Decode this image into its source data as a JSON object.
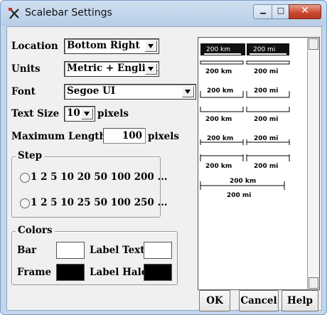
{
  "window": {
    "title": "Scalebar Settings"
  },
  "form": {
    "location_label": "Location",
    "location_value": "Bottom Right",
    "units_label": "Units",
    "units_value": "Metric + English",
    "font_label": "Font",
    "font_value": "Segoe UI",
    "text_size_label": "Text Size",
    "text_size_value": "10",
    "text_size_unit": "pixels",
    "max_length_label": "Maximum Length",
    "max_length_value": "100",
    "max_length_unit": "pixels"
  },
  "step": {
    "title": "Step",
    "option1": "1 2 5 10 20 50 100 200 ...",
    "option2": "1 2 5 10 25 50 100 250 ..."
  },
  "colors": {
    "title": "Colors",
    "bar_label": "Bar",
    "bar_color": "#ffffff",
    "label_text_label": "Label Text",
    "label_text_color": "#ffffff",
    "frame_label": "Frame",
    "frame_color": "#000000",
    "label_halo_label": "Label Halo",
    "label_halo_color": "#000000"
  },
  "preview": {
    "km": "200 km",
    "mi": "200 mi"
  },
  "buttons": {
    "ok": "OK",
    "cancel": "Cancel",
    "help": "Help"
  }
}
